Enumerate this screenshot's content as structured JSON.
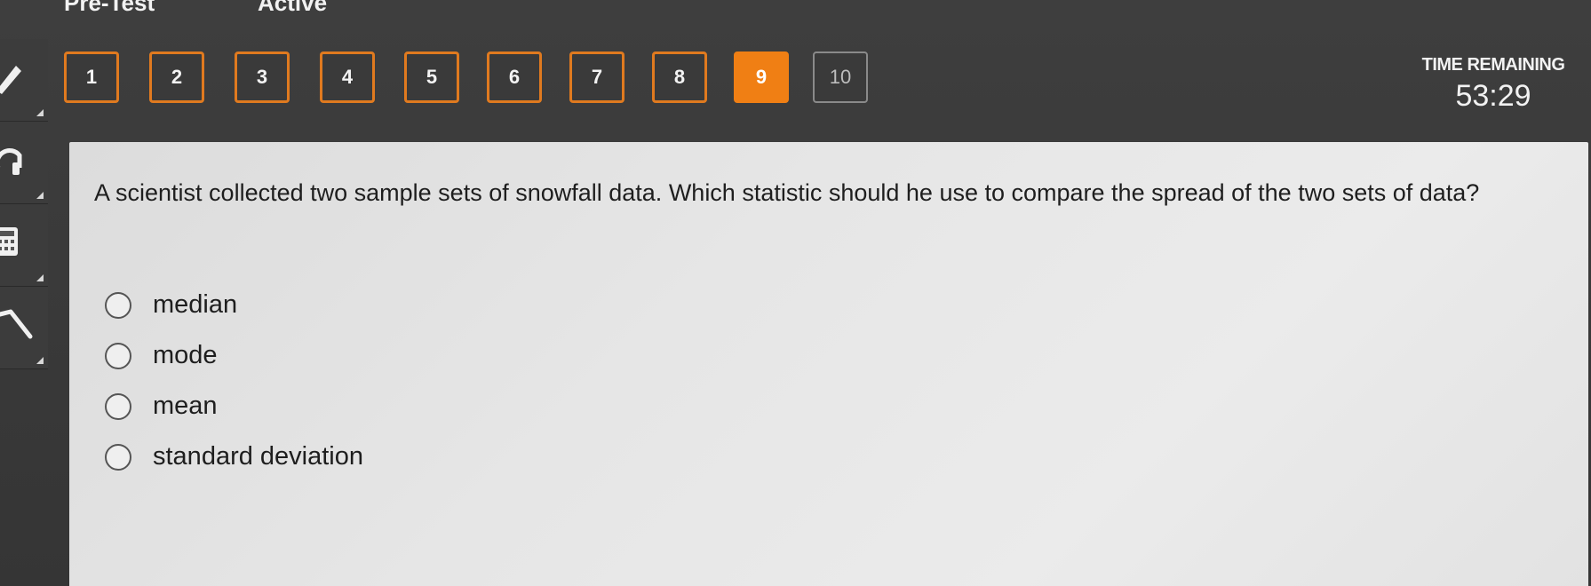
{
  "topbar": {
    "section": "Pre-Test",
    "status": "Active"
  },
  "tools": [
    {
      "icon": "pencil-icon"
    },
    {
      "icon": "headphones-icon"
    },
    {
      "icon": "calculator-icon"
    },
    {
      "icon": "line-tool-icon"
    }
  ],
  "nav": {
    "questions": [
      "1",
      "2",
      "3",
      "4",
      "5",
      "6",
      "7",
      "8",
      "9",
      "10"
    ],
    "current": "9",
    "answered": [
      "1",
      "2",
      "3",
      "4",
      "5",
      "6",
      "7",
      "8"
    ],
    "unvisited": [
      "10"
    ]
  },
  "timer": {
    "label": "TIME REMAINING",
    "value": "53:29"
  },
  "question": {
    "text": "A scientist collected two sample sets of snowfall data. Which statistic should he use to compare the spread of the two sets of data?",
    "choices": [
      "median",
      "mode",
      "mean",
      "standard deviation"
    ]
  },
  "colors": {
    "accent": "#f07f14",
    "answered_border": "#e07a1f",
    "background": "#3a3a3a",
    "panel": "#e6e6e6"
  }
}
